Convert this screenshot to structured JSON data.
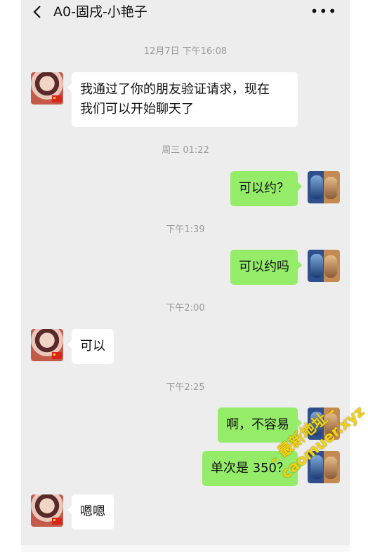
{
  "header": {
    "title": "A0-固戌-小艳子",
    "back_icon": "chevron-left-icon",
    "more_label": "•••"
  },
  "messages": [
    {
      "type": "time",
      "text": "12月7日 下午16:08"
    },
    {
      "type": "msg",
      "side": "left",
      "text1": "我通过了你的朋友验证请求，现在",
      "text2": "我们可以开始聊天了"
    },
    {
      "type": "time",
      "text": "周三 01:22"
    },
    {
      "type": "msg",
      "side": "right",
      "text": "可以约？"
    },
    {
      "type": "time",
      "text": "下午1:39"
    },
    {
      "type": "msg",
      "side": "right",
      "text": "可以约吗"
    },
    {
      "type": "time",
      "text": "下午2:00"
    },
    {
      "type": "msg",
      "side": "left",
      "text": "可以"
    },
    {
      "type": "time",
      "text": "下午2:25"
    },
    {
      "type": "msg",
      "side": "right",
      "text": "啊，不容易"
    },
    {
      "type": "msg",
      "side": "right",
      "text": "单次是 350？"
    },
    {
      "type": "msg",
      "side": "left",
      "text": "嗯嗯"
    }
  ],
  "watermark": {
    "line1": "- 最新地址 -",
    "line2": "caomuer.xyz"
  },
  "colors": {
    "background": "#ededed",
    "bubble_right": "#95ec69",
    "bubble_left": "#ffffff",
    "timestamp": "#9a9a9a",
    "watermark": "#f2d310"
  }
}
